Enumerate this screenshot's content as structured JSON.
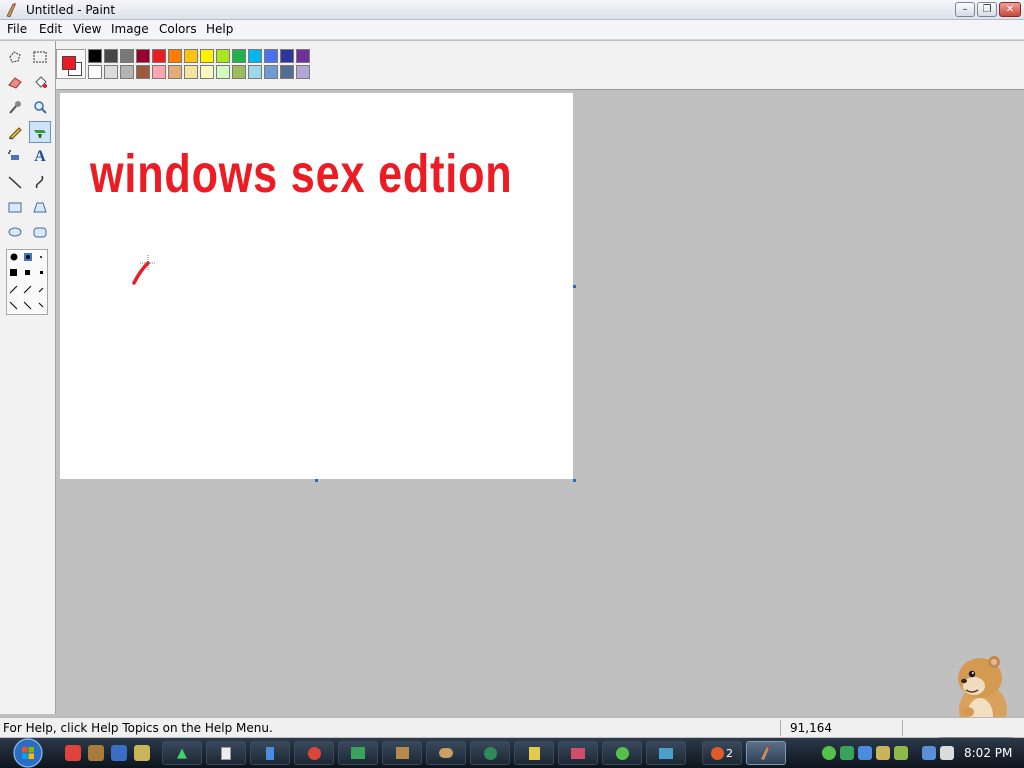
{
  "window": {
    "title": "Untitled - Paint"
  },
  "menu": [
    "File",
    "Edit",
    "View",
    "Image",
    "Colors",
    "Help"
  ],
  "canvas": {
    "text": "windows sex edtion",
    "text_color": "#ed1c24"
  },
  "colors": {
    "foreground": "#ed1c24",
    "background": "#ffffff",
    "palette_row1": [
      "#000000",
      "#464646",
      "#787878",
      "#990030",
      "#ed1c24",
      "#ff7e00",
      "#ffc20e",
      "#fff200",
      "#a8e61d",
      "#22b14c",
      "#00b7ef",
      "#4d6df3",
      "#2f3699",
      "#6f3198"
    ],
    "palette_row2": [
      "#ffffff",
      "#dcdcdc",
      "#b4b4b4",
      "#9c5a3c",
      "#ffa3b1",
      "#e5aa7a",
      "#f5e49c",
      "#fff9bd",
      "#d3f9bc",
      "#9dbb61",
      "#99d9ea",
      "#709ad1",
      "#546d8e",
      "#b5a5d5"
    ]
  },
  "status": {
    "help": "For Help, click Help Topics on the Help Menu.",
    "coords": "91,164"
  },
  "taskbar": {
    "clock": "8:02 PM"
  }
}
